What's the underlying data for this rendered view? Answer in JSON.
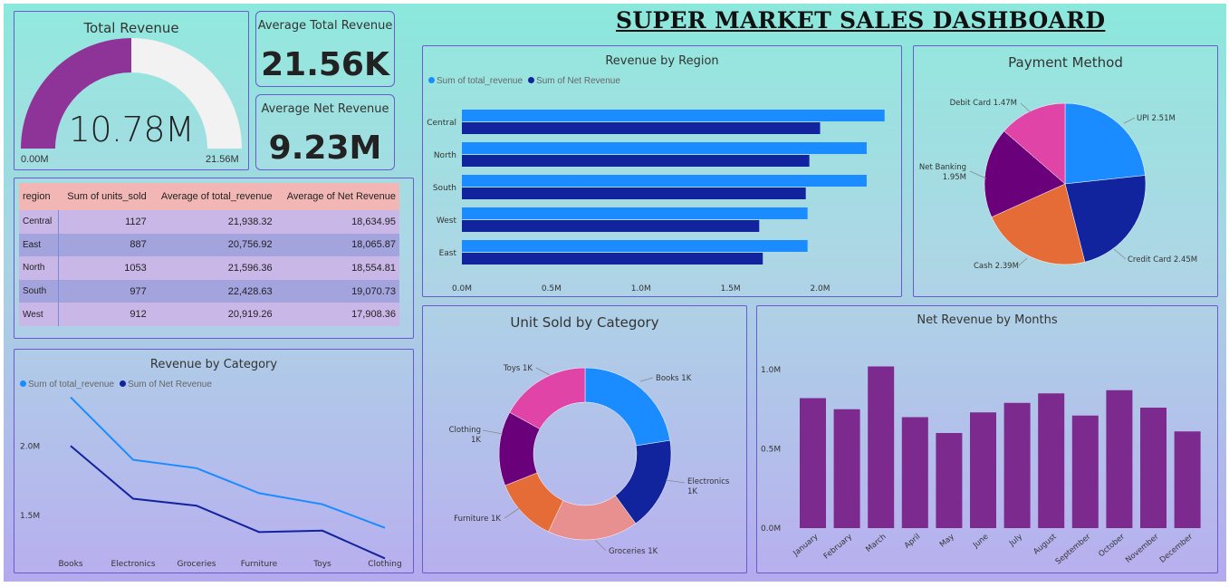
{
  "title": "SUPER MARKET SALES DASHBOARD",
  "colors": {
    "total": "#1a8cff",
    "net": "#12239e",
    "purple": "#7d2a8f",
    "gauge_fill": "#8e3499",
    "gauge_bg": "#f2f2f2"
  },
  "gauge": {
    "title": "Total Revenue",
    "value_label": "10.78M",
    "min_label": "0.00M",
    "max_label": "21.56M",
    "value": 10.78,
    "max": 21.56
  },
  "kpi_total": {
    "title": "Average Total Revenue",
    "value": "21.56K"
  },
  "kpi_net": {
    "title": "Average Net Revenue",
    "value": "9.23M"
  },
  "table": {
    "headers": [
      "region",
      "Sum of units_sold",
      "Average of total_revenue",
      "Average of Net Revenue"
    ],
    "rows": [
      [
        "Central",
        "1127",
        "21,938.32",
        "18,634.95"
      ],
      [
        "East",
        "887",
        "20,756.92",
        "18,065.87"
      ],
      [
        "North",
        "1053",
        "21,596.36",
        "18,554.81"
      ],
      [
        "South",
        "977",
        "22,428.63",
        "19,070.73"
      ],
      [
        "West",
        "912",
        "20,919.26",
        "17,908.36"
      ]
    ]
  },
  "chart_data": [
    {
      "id": "region",
      "type": "bar",
      "orientation": "horizontal",
      "title": "Revenue by Region",
      "categories": [
        "Central",
        "North",
        "South",
        "West",
        "East"
      ],
      "series": [
        {
          "name": "Sum of total_revenue",
          "values": [
            2.36,
            2.26,
            2.26,
            1.93,
            1.93
          ]
        },
        {
          "name": "Sum of Net Revenue",
          "values": [
            2.0,
            1.94,
            1.92,
            1.66,
            1.68
          ]
        }
      ],
      "xticks": [
        "0.0M",
        "0.5M",
        "1.0M",
        "1.5M",
        "2.0M"
      ],
      "xlim": [
        0,
        2.4
      ],
      "legend": "top-left"
    },
    {
      "id": "payment",
      "type": "pie",
      "title": "Payment Method",
      "labels": [
        "UPI 2.51M",
        "Credit Card 2.45M",
        "Cash 2.39M",
        "Net Banking 1.95M",
        "Debit Card 1.47M"
      ],
      "values": [
        2.51,
        2.45,
        2.39,
        1.95,
        1.47
      ],
      "colors": [
        "#1a8cff",
        "#12239e",
        "#e66c37",
        "#6b007b",
        "#e044a7"
      ]
    },
    {
      "id": "category_line",
      "type": "line",
      "title": "Revenue by Category",
      "categories": [
        "Books",
        "Electronics",
        "Groceries",
        "Furniture",
        "Toys",
        "Clothing"
      ],
      "series": [
        {
          "name": "Sum of total_revenue",
          "values": [
            2.35,
            1.9,
            1.84,
            1.66,
            1.58,
            1.41
          ]
        },
        {
          "name": "Sum of Net Revenue",
          "values": [
            2.0,
            1.62,
            1.57,
            1.38,
            1.39,
            1.19
          ]
        }
      ],
      "yticks": [
        "2.0M",
        "1.5M"
      ],
      "ylim": [
        1.18,
        2.38
      ],
      "legend": "top-left"
    },
    {
      "id": "units_donut",
      "type": "pie",
      "title": "Unit Sold by Category",
      "labels": [
        "Books 1K",
        "Electronics 1K",
        "Groceries 1K",
        "Furniture 1K",
        "Clothing 1K",
        "Toys 1K"
      ],
      "values": [
        22.5,
        17.5,
        17,
        12,
        14,
        17
      ],
      "colors": [
        "#1a8cff",
        "#12239e",
        "#e8908f",
        "#e66c37",
        "#6b007b",
        "#e044a7"
      ]
    },
    {
      "id": "months",
      "type": "bar",
      "title": "Net Revenue by Months",
      "categories": [
        "January",
        "February",
        "March",
        "April",
        "May",
        "June",
        "July",
        "August",
        "September",
        "October",
        "November",
        "December"
      ],
      "values": [
        0.82,
        0.75,
        1.02,
        0.7,
        0.6,
        0.73,
        0.79,
        0.85,
        0.71,
        0.87,
        0.76,
        0.61
      ],
      "yticks": [
        "0.0M",
        "0.5M",
        "1.0M"
      ],
      "ylim": [
        0,
        1.0
      ]
    }
  ]
}
